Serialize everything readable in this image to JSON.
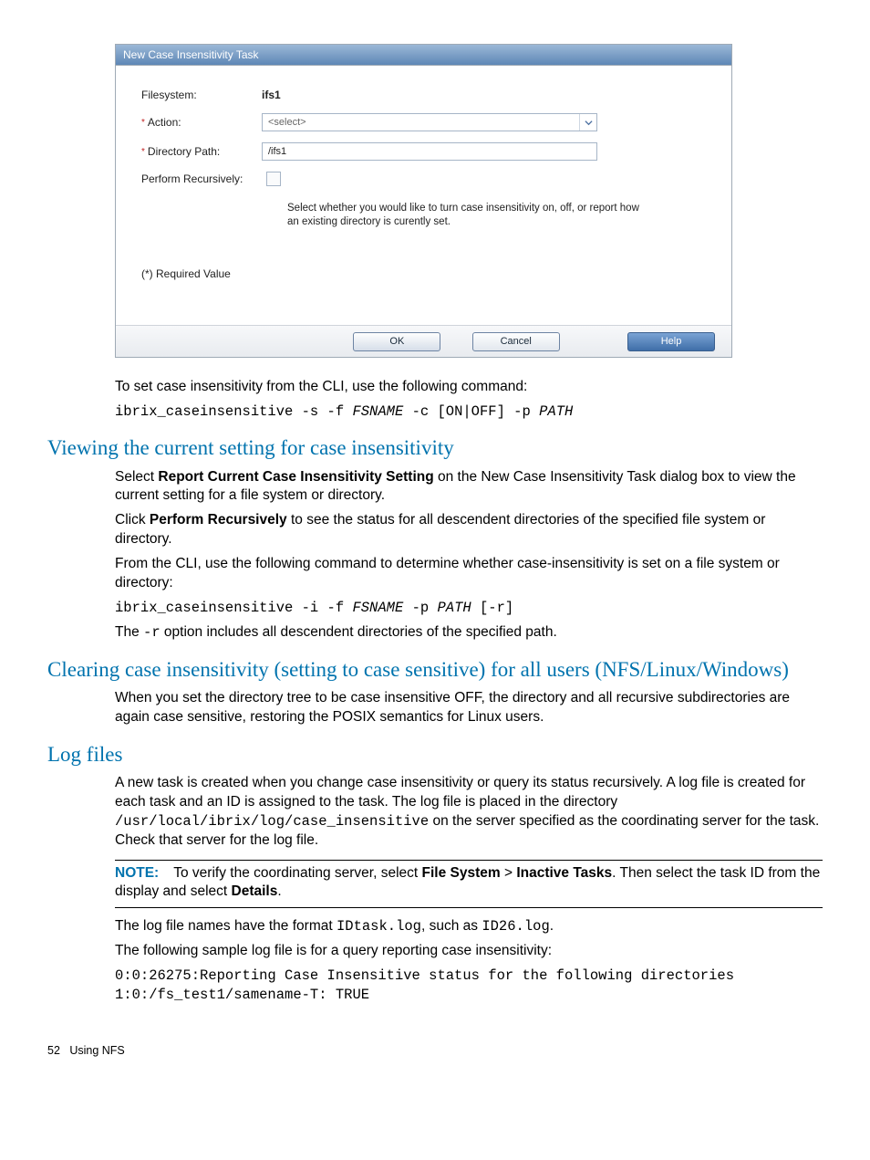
{
  "dialog": {
    "title": "New Case Insensitivity Task",
    "filesystem_label": "Filesystem:",
    "filesystem_value": "ifs1",
    "action_label": "Action:",
    "action_placeholder": "<select>",
    "dirpath_label": "Directory Path:",
    "dirpath_value": "/ifs1",
    "recursive_label": "Perform Recursively:",
    "helper_text": "Select whether you would like to turn case insensitivity on, off, or report how an existing directory is curently set.",
    "required_note": "(*) Required Value",
    "ok": "OK",
    "cancel": "Cancel",
    "help": "Help"
  },
  "body": {
    "cli_intro": "To set case insensitivity from the CLI, use the following command:",
    "cli_cmd_parts": {
      "p1": "ibrix_caseinsensitive -s -f ",
      "p2": "FSNAME",
      "p3": " -c [ON|OFF] -p ",
      "p4": "PATH"
    },
    "h_view": "Viewing the current setting for case insensitivity",
    "view_p1a": "Select ",
    "view_p1b": "Report Current Case Insensitivity Setting",
    "view_p1c": " on the New Case Insensitivity Task dialog box to view the current setting for a file system or directory.",
    "view_p2a": "Click ",
    "view_p2b": "Perform Recursively",
    "view_p2c": " to see the status for all descendent directories of the specified file system or directory.",
    "view_p3": "From the CLI, use the following command to determine whether case-insensitivity is set on a file system or directory:",
    "view_cmd_parts": {
      "p1": "ibrix_caseinsensitive -i -f ",
      "p2": "FSNAME",
      "p3": " -p ",
      "p4": "PATH",
      "p5": " [-r]"
    },
    "view_p4a": "The ",
    "view_p4b": "-r",
    "view_p4c": " option includes all descendent directories of the specified path.",
    "h_clear": "Clearing case insensitivity (setting to case sensitive) for all users (NFS/Linux/Windows)",
    "clear_p1": "When you set the directory tree to be case insensitive OFF, the directory and all recursive subdirectories are again case sensitive, restoring the POSIX semantics for Linux users.",
    "h_log": "Log files",
    "log_p1a": "A new task is created when you change case insensitivity or query its status recursively. A log file is created for each task and an ID is assigned to the task. The log file is placed in the directory ",
    "log_p1b": "/usr/local/ibrix/log/case_insensitive",
    "log_p1c": " on the server specified as the coordinating server for the task. Check that server for the log file.",
    "note_label": "NOTE:",
    "note_a": "To verify the coordinating server, select ",
    "note_b": "File System",
    "note_gt": " > ",
    "note_c": "Inactive Tasks",
    "note_d": ". Then select the task ID from the display and select ",
    "note_e": "Details",
    "note_f": ".",
    "log_p2a": "The log file names have the format ",
    "log_p2b": "IDtask.log",
    "log_p2c": ", such as ",
    "log_p2d": "ID26.log",
    "log_p2e": ".",
    "log_p3": "The following sample log file is for a query reporting case insensitivity:",
    "log_sample1": "0:0:26275:Reporting Case Insensitive status for the following directories",
    "log_sample2": "1:0:/fs_test1/samename-T: TRUE"
  },
  "footer": {
    "page_num": "52",
    "chapter": "Using NFS"
  }
}
